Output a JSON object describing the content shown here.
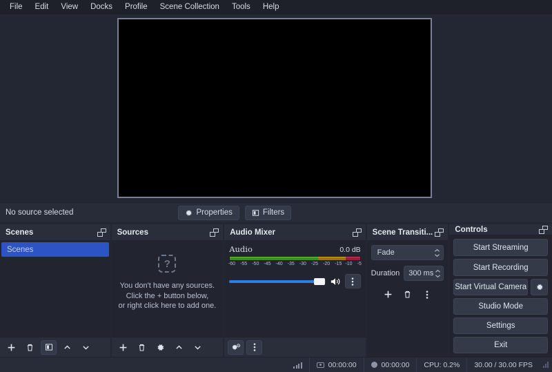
{
  "menubar": {
    "items": [
      {
        "label": "File"
      },
      {
        "label": "Edit"
      },
      {
        "label": "View"
      },
      {
        "label": "Docks"
      },
      {
        "label": "Profile"
      },
      {
        "label": "Scene Collection"
      },
      {
        "label": "Tools"
      },
      {
        "label": "Help"
      }
    ]
  },
  "source_toolbar": {
    "status_text": "No source selected",
    "properties_label": "Properties",
    "filters_label": "Filters"
  },
  "scenes": {
    "title": "Scenes",
    "items": [
      {
        "label": "Scenes",
        "selected": true
      }
    ],
    "buttons": [
      {
        "name": "add-scene",
        "glyph": "+"
      },
      {
        "name": "remove-scene",
        "glyph": "trash"
      },
      {
        "name": "scene-filters",
        "glyph": "filter"
      },
      {
        "name": "move-scene-up",
        "glyph": "chevron-up"
      },
      {
        "name": "move-scene-down",
        "glyph": "chevron-down"
      }
    ]
  },
  "sources": {
    "title": "Sources",
    "empty_icon": "question-mark-placeholder",
    "empty_lines": [
      "You don't have any sources.",
      "Click the + button below,",
      "or right click here to add one."
    ],
    "buttons": [
      {
        "name": "add-source",
        "glyph": "+"
      },
      {
        "name": "remove-source",
        "glyph": "trash"
      },
      {
        "name": "source-properties",
        "glyph": "gear"
      },
      {
        "name": "move-source-up",
        "glyph": "chevron-up"
      },
      {
        "name": "move-source-down",
        "glyph": "chevron-down"
      }
    ]
  },
  "audio_mixer": {
    "title": "Audio Mixer",
    "channel_name": "Audio",
    "level_label": "0.0 dB",
    "ticks": [
      "-60",
      "-55",
      "-50",
      "-45",
      "-40",
      "-35",
      "-30",
      "-25",
      "-20",
      "-15",
      "-10",
      "-5"
    ],
    "volume_percent": 91,
    "buttons": [
      {
        "name": "advanced-audio-properties",
        "glyph": "gears"
      },
      {
        "name": "audio-mixer-menu",
        "glyph": "kebab"
      }
    ]
  },
  "scene_transitions": {
    "title": "Scene Transiti...",
    "transition_value": "Fade",
    "duration_label": "Duration",
    "duration_value": "300 ms",
    "buttons": [
      {
        "name": "add-transition",
        "glyph": "+"
      },
      {
        "name": "remove-transition",
        "glyph": "trash"
      },
      {
        "name": "transition-menu",
        "glyph": "kebab"
      }
    ]
  },
  "controls": {
    "title": "Controls",
    "buttons": [
      {
        "label": "Start Streaming"
      },
      {
        "label": "Start Recording"
      },
      {
        "label": "Start Virtual Camera"
      },
      {
        "label": "Studio Mode"
      },
      {
        "label": "Settings"
      },
      {
        "label": "Exit"
      }
    ],
    "vcam_settings_icon": "gear-icon"
  },
  "statusbar": {
    "stream_time": "00:00:00",
    "record_time": "00:00:00",
    "cpu": "CPU: 0.2%",
    "fps": "30.00 / 30.00 FPS"
  },
  "colors": {
    "window_bg": "#232733",
    "panel_bg": "#2a2e3a",
    "list_bg": "#22252f",
    "accent_blue": "#2e53c4",
    "slider_blue": "#2e7de0",
    "meter_green": "#3f8f1e",
    "meter_yellow": "#9a7318",
    "meter_red": "#9a1f3c",
    "text": "#d6dae3"
  }
}
